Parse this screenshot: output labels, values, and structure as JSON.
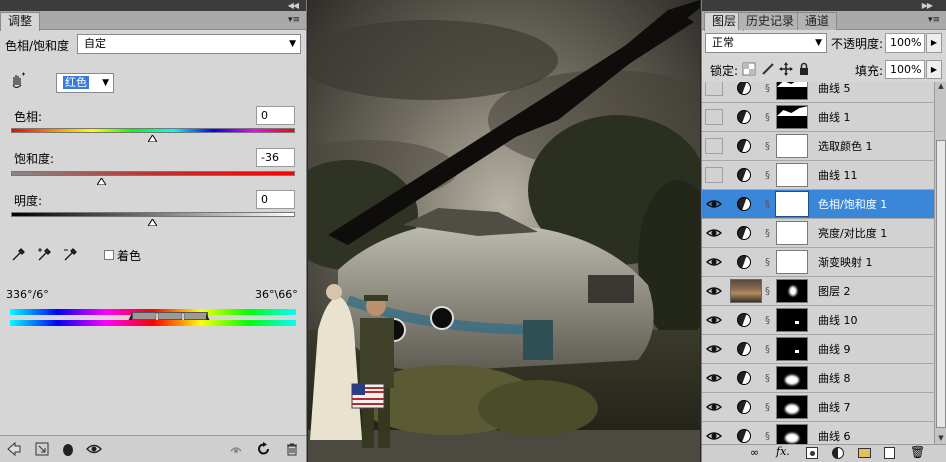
{
  "adjustments": {
    "tabs": [
      {
        "label": "调整"
      }
    ],
    "preset_label": "色相/饱和度",
    "preset_value": "自定",
    "channel_value": "红色",
    "hue_label": "色相:",
    "hue_value": "0",
    "saturation_label": "饱和度:",
    "saturation_value": "-36",
    "lightness_label": "明度:",
    "lightness_value": "0",
    "colorize_label": "着色",
    "range_left": "336°/6°",
    "range_right": "36°\\66°"
  },
  "layers": {
    "tabs": [
      {
        "label": "图层"
      },
      {
        "label": "历史记录"
      },
      {
        "label": "通道"
      }
    ],
    "blend_mode": "正常",
    "opacity_label": "不透明度:",
    "opacity_value": "100%",
    "lock_label": "锁定:",
    "fill_label": "填充:",
    "fill_value": "100%",
    "items": [
      {
        "name": "曲线 5",
        "visible": false,
        "thumb": "curve-dark"
      },
      {
        "name": "曲线 1",
        "visible": false,
        "thumb": "curve-dark"
      },
      {
        "name": "选取颜色 1",
        "visible": false,
        "thumb": "white"
      },
      {
        "name": "曲线 11",
        "visible": false,
        "thumb": "white"
      },
      {
        "name": "色相/饱和度 1",
        "visible": true,
        "selected": true,
        "thumb": "white"
      },
      {
        "name": "亮度/对比度 1",
        "visible": true,
        "thumb": "white"
      },
      {
        "name": "渐变映射 1",
        "visible": true,
        "thumb": "white"
      },
      {
        "name": "图层 2",
        "visible": true,
        "thumb": "pixel"
      },
      {
        "name": "曲线 10",
        "visible": true,
        "thumb": "black"
      },
      {
        "name": "曲线 9",
        "visible": true,
        "thumb": "black"
      },
      {
        "name": "曲线 8",
        "visible": true,
        "thumb": "black-spot"
      },
      {
        "name": "曲线 7",
        "visible": true,
        "thumb": "black-spot"
      },
      {
        "name": "曲线 6",
        "visible": true,
        "thumb": "black-spot"
      }
    ]
  }
}
